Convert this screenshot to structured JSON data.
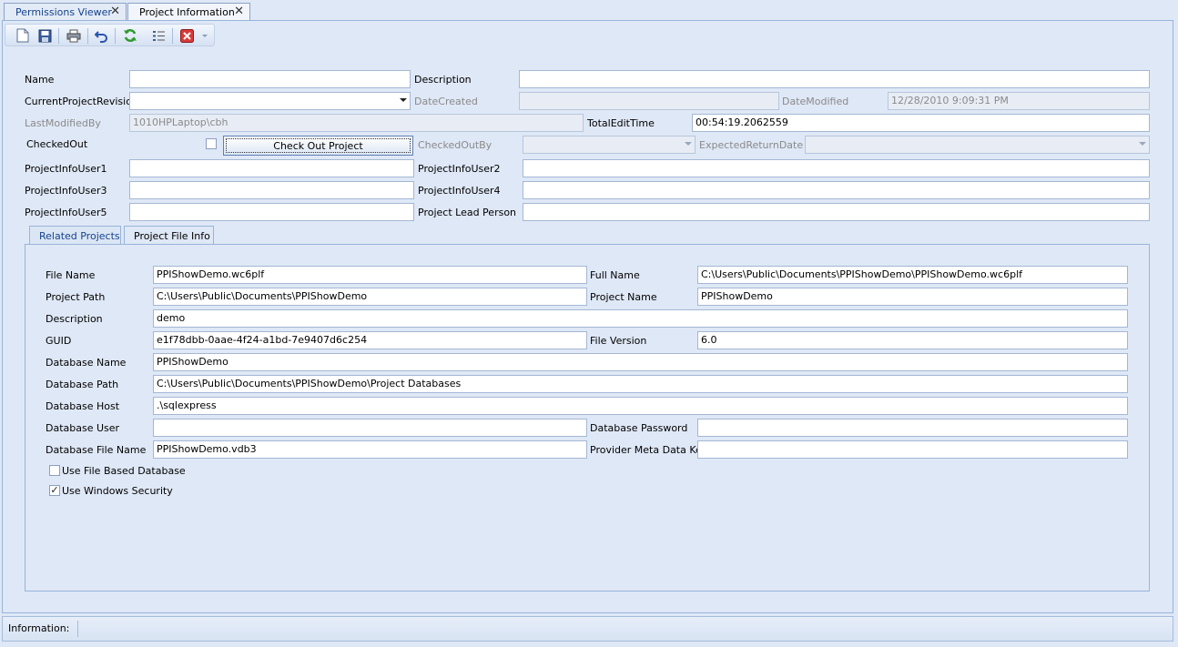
{
  "tabs": [
    {
      "label": "Permissions Viewer",
      "close": "✕"
    },
    {
      "label": "Project Information",
      "close": "✕"
    }
  ],
  "toolbar": {
    "icons": [
      "new-document-icon",
      "save-icon",
      "print-icon",
      "undo-icon",
      "refresh-icon",
      "list-icon",
      "delete-icon",
      "dropdown-arrow-icon"
    ]
  },
  "form": {
    "name_label": "Name",
    "name_value": "",
    "description_label": "Description",
    "description_value": "",
    "current_revision_label": "CurrentProjectRevision",
    "current_revision_value": "",
    "date_created_label": "DateCreated",
    "date_created_value": "",
    "date_modified_label": "DateModified",
    "date_modified_value": "12/28/2010 9:09:31 PM",
    "last_modified_by_label": "LastModifiedBy",
    "last_modified_by_value": "1010HPLaptop\\cbh",
    "total_edit_time_label": "TotalEditTime",
    "total_edit_time_value": "00:54:19.2062559",
    "checked_out_label": "CheckedOut",
    "checked_out": false,
    "check_out_button": "Check Out Project",
    "checked_out_by_label": "CheckedOutBy",
    "checked_out_by_value": "",
    "expected_return_label": "ExpectedReturnDate",
    "expected_return_value": "",
    "user1_label": "ProjectInfoUser1",
    "user1_value": "",
    "user2_label": "ProjectInfoUser2",
    "user2_value": "",
    "user3_label": "ProjectInfoUser3",
    "user3_value": "",
    "user4_label": "ProjectInfoUser4",
    "user4_value": "",
    "user5_label": "ProjectInfoUser5",
    "user5_value": "",
    "lead_person_label": "Project Lead Person",
    "lead_person_value": ""
  },
  "inner_tabs": [
    {
      "label": "Related Projects"
    },
    {
      "label": "Project File Info"
    }
  ],
  "file_info": {
    "file_name_label": "File Name",
    "file_name_value": "PPIShowDemo.wc6plf",
    "full_name_label": "Full Name",
    "full_name_value": "C:\\Users\\Public\\Documents\\PPIShowDemo\\PPIShowDemo.wc6plf",
    "project_path_label": "Project Path",
    "project_path_value": "C:\\Users\\Public\\Documents\\PPIShowDemo",
    "project_name_label": "Project Name",
    "project_name_value": "PPIShowDemo",
    "description_label": "Description",
    "description_value": "demo",
    "guid_label": "GUID",
    "guid_value": "e1f78dbb-0aae-4f24-a1bd-7e9407d6c254",
    "file_version_label": "File Version",
    "file_version_value": "6.0",
    "db_name_label": "Database Name",
    "db_name_value": "PPIShowDemo",
    "db_path_label": "Database Path",
    "db_path_value": "C:\\Users\\Public\\Documents\\PPIShowDemo\\Project Databases",
    "db_host_label": "Database Host",
    "db_host_value": ".\\sqlexpress",
    "db_user_label": "Database User",
    "db_user_value": "",
    "db_password_label": "Database Password",
    "db_password_value": "",
    "db_file_name_label": "Database File Name",
    "db_file_name_value": "PPIShowDemo.vdb3",
    "provider_key_label": "Provider Meta Data Key",
    "provider_key_value": "",
    "use_file_db_label": "Use File Based Database",
    "use_file_db": false,
    "use_win_security_label": "Use Windows Security",
    "use_win_security": true,
    "check_mark": "✓"
  },
  "status": {
    "label": "Information:"
  }
}
